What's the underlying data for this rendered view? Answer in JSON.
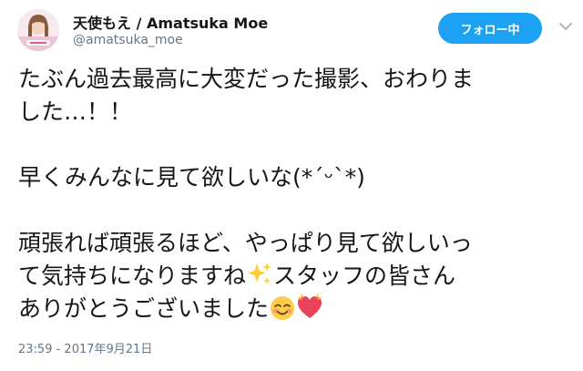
{
  "author": {
    "display_name": "天使もえ / Amatsuka Moe",
    "handle": "@amatsuka_moe",
    "avatar_icon": "avatar-photo"
  },
  "follow_button": {
    "label": "フォロー中",
    "color": "#1da1f2"
  },
  "tweet": {
    "lines": [
      "たぶん過去最高に大変だった撮影、おわりま",
      "した…！！",
      "",
      "早くみんなに見て欲しいな(*ˊᵕˋ*)",
      "",
      "頑張れば頑張るほど、やっぱり見て欲しいっ",
      "て気持ちになりますね",
      "スタッフの皆さん",
      "ありがとうございました"
    ],
    "emoji": [
      "sparkles-icon",
      "smiling-face-icon",
      "heart-icon"
    ],
    "timestamp": "23:59 - 2017年9月21日"
  },
  "colors": {
    "text": "#14171a",
    "secondary_text": "#657786",
    "accent": "#1da1f2"
  }
}
